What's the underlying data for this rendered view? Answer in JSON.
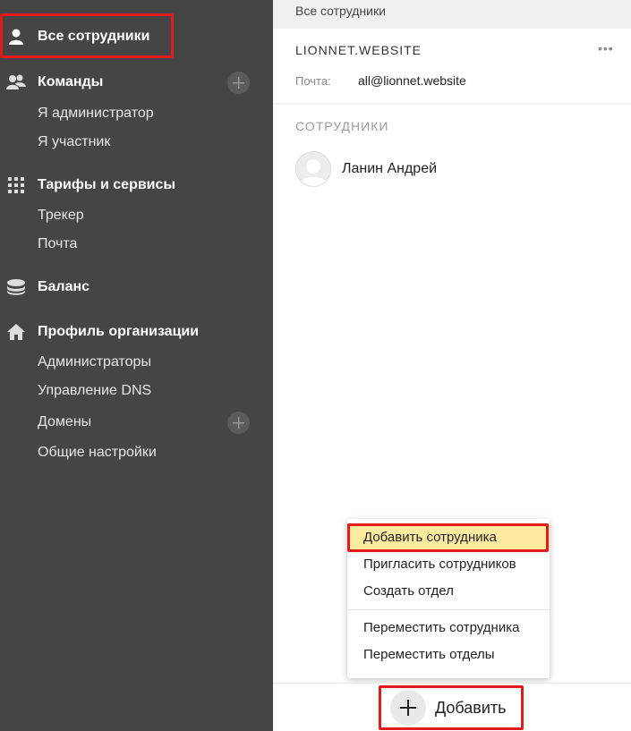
{
  "sidebar": {
    "all_employees": "Все сотрудники",
    "teams": "Команды",
    "teams_items": [
      "Я администратор",
      "Я участник"
    ],
    "tariffs": "Тарифы и сервисы",
    "tariffs_items": [
      "Трекер",
      "Почта"
    ],
    "balance": "Баланс",
    "org_profile": "Профиль организации",
    "org_items": [
      "Администраторы",
      "Управление DNS",
      "Домены",
      "Общие настройки"
    ]
  },
  "main": {
    "breadcrumb": "Все сотрудники",
    "org_name": "LIONNET.WEBSITE",
    "more_dots": "•••",
    "mail_label": "Почта:",
    "mail_value": "all@lionnet.website",
    "section_title": "СОТРУДНИКИ",
    "employees": [
      "Ланин Андрей"
    ]
  },
  "menu": {
    "items": [
      "Добавить сотрудника",
      "Пригласить сотрудников",
      "Создать отдел",
      "Переместить сотрудника",
      "Переместить отделы"
    ]
  },
  "bottom": {
    "add_label": "Добавить"
  },
  "colors": {
    "sidebar_bg": "#454545",
    "highlight_red": "#e31b1b",
    "menu_active": "#ffeba0"
  }
}
